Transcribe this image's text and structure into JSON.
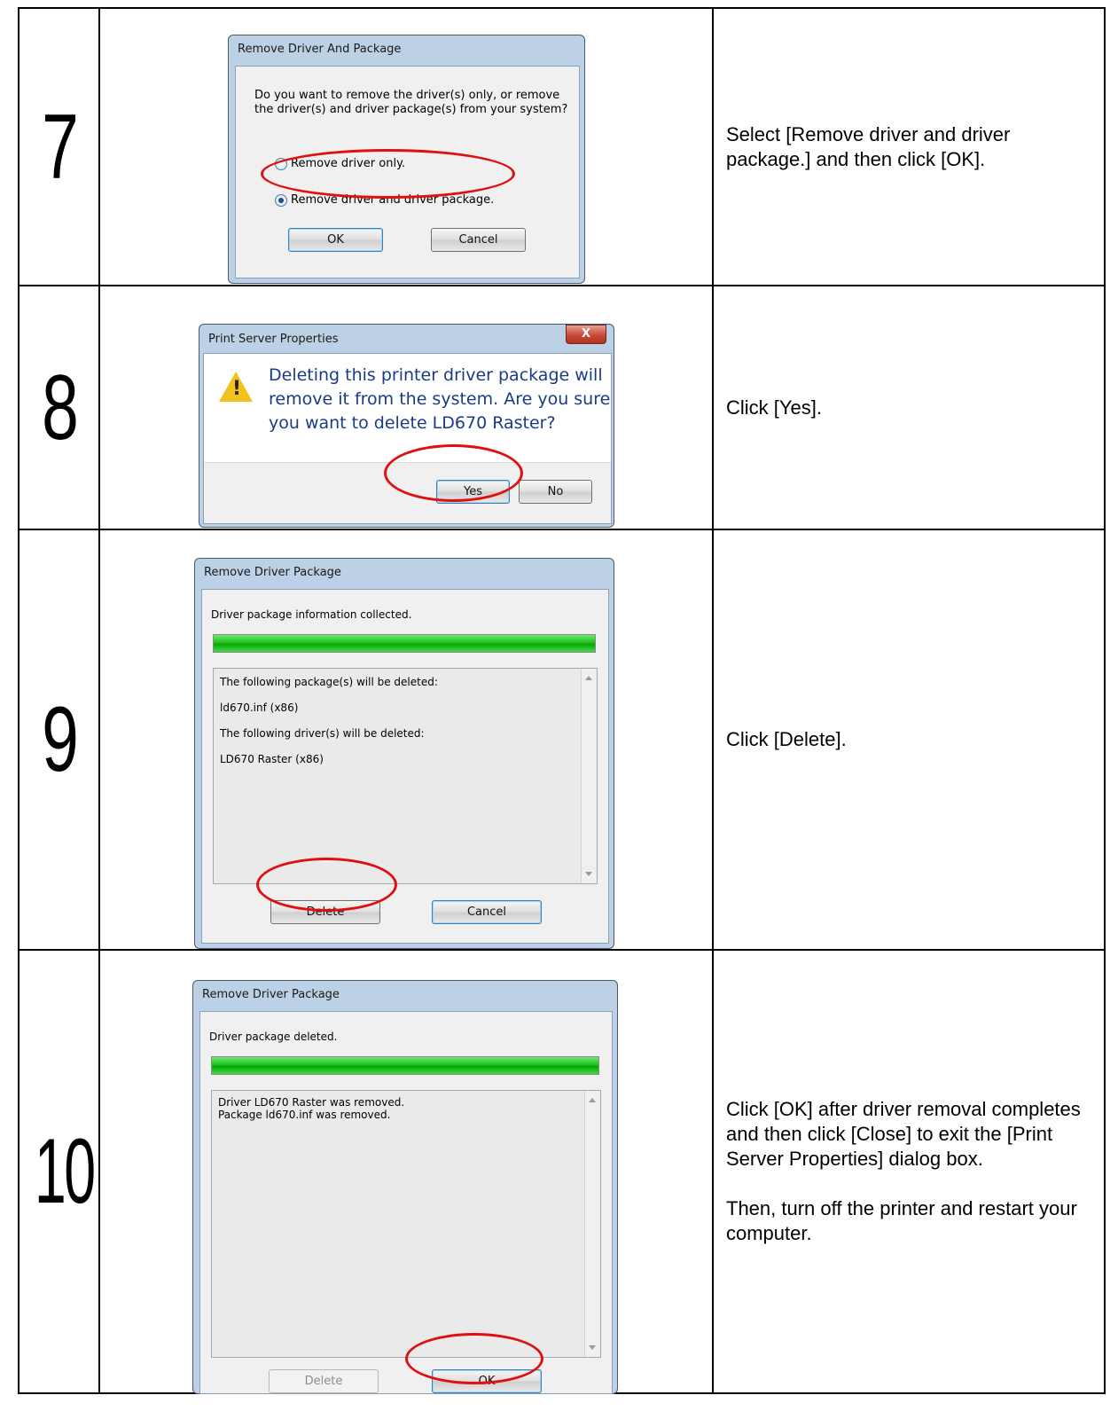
{
  "steps": [
    {
      "number": "7",
      "instruction": [
        "Select [Remove driver and driver package.] and then click [OK]."
      ],
      "dialog": {
        "title": "Remove Driver And Package",
        "question_line1": "Do you want to remove the driver(s) only, or remove",
        "question_line2": "the driver(s) and driver package(s) from your system?",
        "radio_1": "Remove driver only.",
        "radio_2": "Remove driver and driver package.",
        "radio_selected": "radio_2",
        "ok_label": "OK",
        "cancel_label": "Cancel"
      }
    },
    {
      "number": "8",
      "instruction": [
        "Click [Yes]."
      ],
      "dialog": {
        "title": "Print Server Properties",
        "close_glyph": "X",
        "message_line1": "Deleting this printer driver package will",
        "message_line2": "remove it from the system. Are you sure",
        "message_line3": "you want to delete LD670 Raster?",
        "yes_label": "Yes",
        "no_label": "No"
      }
    },
    {
      "number": "9",
      "instruction": [
        "Click [Delete]."
      ],
      "dialog": {
        "title": "Remove Driver Package",
        "status": "Driver package information collected.",
        "progress_fraction": 1.0,
        "list": [
          "The following package(s) will be deleted:",
          "ld670.inf (x86)",
          "The following driver(s) will be deleted:",
          "LD670 Raster (x86)"
        ],
        "delete_label": "Delete",
        "cancel_label": "Cancel"
      }
    },
    {
      "number": "10",
      "instruction": [
        "Click [OK] after driver removal completes and then click [Close] to exit the [Print Server Properties] dialog box.",
        "Then, turn off the printer and restart your computer."
      ],
      "dialog": {
        "title": "Remove Driver Package",
        "status": "Driver package deleted.",
        "progress_fraction": 1.0,
        "list": [
          "Driver LD670 Raster was removed.",
          "Package ld670.inf was removed."
        ],
        "delete_label": "Delete",
        "ok_label": "OK"
      }
    }
  ],
  "colors": {
    "highlight_oval": "#e01010",
    "progress_fill": "#1ec21e",
    "warning_icon": "#f2c11c"
  }
}
